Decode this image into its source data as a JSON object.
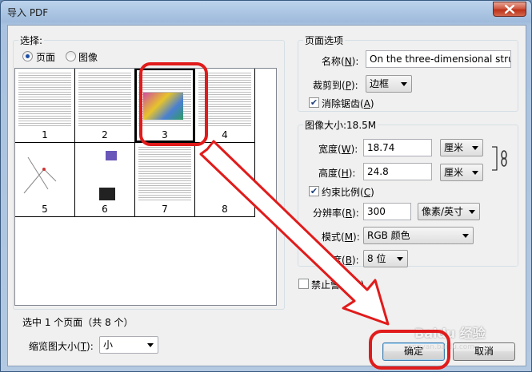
{
  "window": {
    "title": "导入 PDF"
  },
  "select": {
    "legend": "选择:",
    "radio_page": "页面",
    "radio_image": "图像",
    "pages": [
      {
        "num": "1"
      },
      {
        "num": "2"
      },
      {
        "num": "3"
      },
      {
        "num": "4"
      },
      {
        "num": "5"
      },
      {
        "num": "6"
      },
      {
        "num": "7"
      },
      {
        "num": "8"
      }
    ],
    "status": "选中 1 个页面（共 8 个）",
    "thumb_size_label": "缩览图大小(",
    "thumb_size_key": "T",
    "thumb_size_value": "小"
  },
  "page_options": {
    "legend": "页面选项",
    "name_label": "名称(",
    "name_key": "N",
    "name_value": "On the three-dimensional struct",
    "crop_label": "裁剪到(",
    "crop_key": "P",
    "crop_value": "边框",
    "antialias_label": "消除锯齿(",
    "antialias_key": "A",
    "antialias_checked": true
  },
  "image_size": {
    "legend": "图像大小:18.5M",
    "width_label": "宽度(",
    "width_key": "W",
    "width_value": "18.74",
    "width_unit": "厘米",
    "height_label": "高度(",
    "height_key": "H",
    "height_value": "24.8",
    "height_unit": "厘米",
    "constrain_label": "约束比例(",
    "constrain_key": "C",
    "constrain_checked": true,
    "resolution_label": "分辨率(",
    "resolution_key": "R",
    "resolution_value": "300",
    "resolution_unit": "像素/英寸",
    "mode_label": "模式(",
    "mode_key": "M",
    "mode_value": "RGB 颜色",
    "depth_label": "位深度(",
    "depth_key": "B",
    "depth_value": "8 位"
  },
  "suppress_warnings": {
    "label": "禁止警告(U)",
    "checked": false
  },
  "buttons": {
    "ok": "确定",
    "cancel": "取消"
  },
  "watermark": {
    "text": "Baidu 经验",
    "sub": "jingyan.baidu.com"
  },
  "colors": {
    "annotation_red": "#e11b1b",
    "title_gradient": "#9fbbdc"
  }
}
